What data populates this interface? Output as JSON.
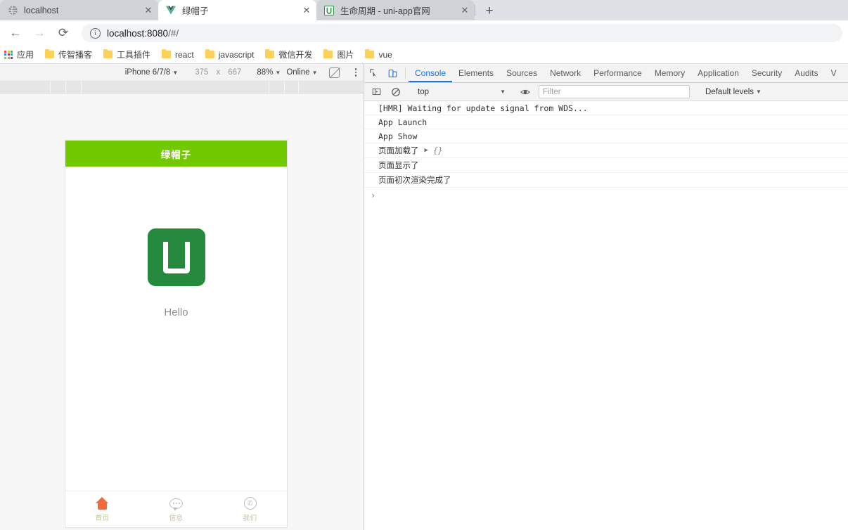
{
  "browser": {
    "tabs": [
      {
        "title": "localhost",
        "favicon": "globe-icon",
        "active": false,
        "close_label": "✕"
      },
      {
        "title": "绿帽子",
        "favicon": "vue-logo-icon",
        "active": true,
        "close_label": "✕"
      },
      {
        "title": "生命周期 - uni-app官网",
        "favicon": "uniapp-logo-icon",
        "active": false,
        "close_label": "✕"
      }
    ],
    "new_tab_label": "+",
    "nav": {
      "back": "←",
      "forward": "→",
      "reload": "⟳",
      "info_glyph": "i"
    },
    "omnibox": {
      "host": "localhost:8080",
      "path": "/#/",
      "full_url": "localhost:8080/#/"
    },
    "bookmarks": {
      "apps_label": "应用",
      "items": [
        {
          "label": "传智播客"
        },
        {
          "label": "工具插件"
        },
        {
          "label": "react"
        },
        {
          "label": "javascript"
        },
        {
          "label": "微信开发"
        },
        {
          "label": "图片"
        },
        {
          "label": "vue"
        }
      ]
    }
  },
  "device_toolbar": {
    "device": "iPhone 6/7/8",
    "width": "375",
    "x_label": "x",
    "height": "667",
    "zoom": "88%",
    "throttle": "Online",
    "rotate_title": "rotate-icon",
    "menu_title": "more-options-icon"
  },
  "app": {
    "header_title": "绿帽子",
    "header_color": "#73c900",
    "logo_color": "#258a3d",
    "logo_letter": "U",
    "hello_text": "Hello",
    "tabbar": [
      {
        "label": "首页",
        "icon": "home-icon",
        "active": true
      },
      {
        "label": "信息",
        "icon": "chat-bubble-icon",
        "active": false
      },
      {
        "label": "我们",
        "icon": "phone-circle-icon",
        "active": false
      }
    ]
  },
  "devtools": {
    "inspect_icon": "inspect-element-icon",
    "device_toggle_icon": "toggle-device-toolbar-icon",
    "panels": [
      {
        "label": "Console",
        "active": true
      },
      {
        "label": "Elements",
        "active": false
      },
      {
        "label": "Sources",
        "active": false
      },
      {
        "label": "Network",
        "active": false
      },
      {
        "label": "Performance",
        "active": false
      },
      {
        "label": "Memory",
        "active": false
      },
      {
        "label": "Application",
        "active": false
      },
      {
        "label": "Security",
        "active": false
      },
      {
        "label": "Audits",
        "active": false
      },
      {
        "label": "V",
        "active": false
      }
    ],
    "console_toolbar": {
      "sidebar_icon": "console-sidebar-icon",
      "clear_icon": "clear-console-icon",
      "context": "top",
      "eye_icon": "live-expression-icon",
      "filter_placeholder": "Filter",
      "levels": "Default levels"
    },
    "logs": [
      {
        "text": "[HMR] Waiting for update signal from WDS...",
        "object": ""
      },
      {
        "text": "App Launch",
        "object": ""
      },
      {
        "text": "App Show",
        "object": ""
      },
      {
        "text": "页面加载了",
        "object": "{}"
      },
      {
        "text": "页面显示了",
        "object": ""
      },
      {
        "text": "页面初次渲染完成了",
        "object": ""
      }
    ],
    "prompt_glyph": "›"
  }
}
